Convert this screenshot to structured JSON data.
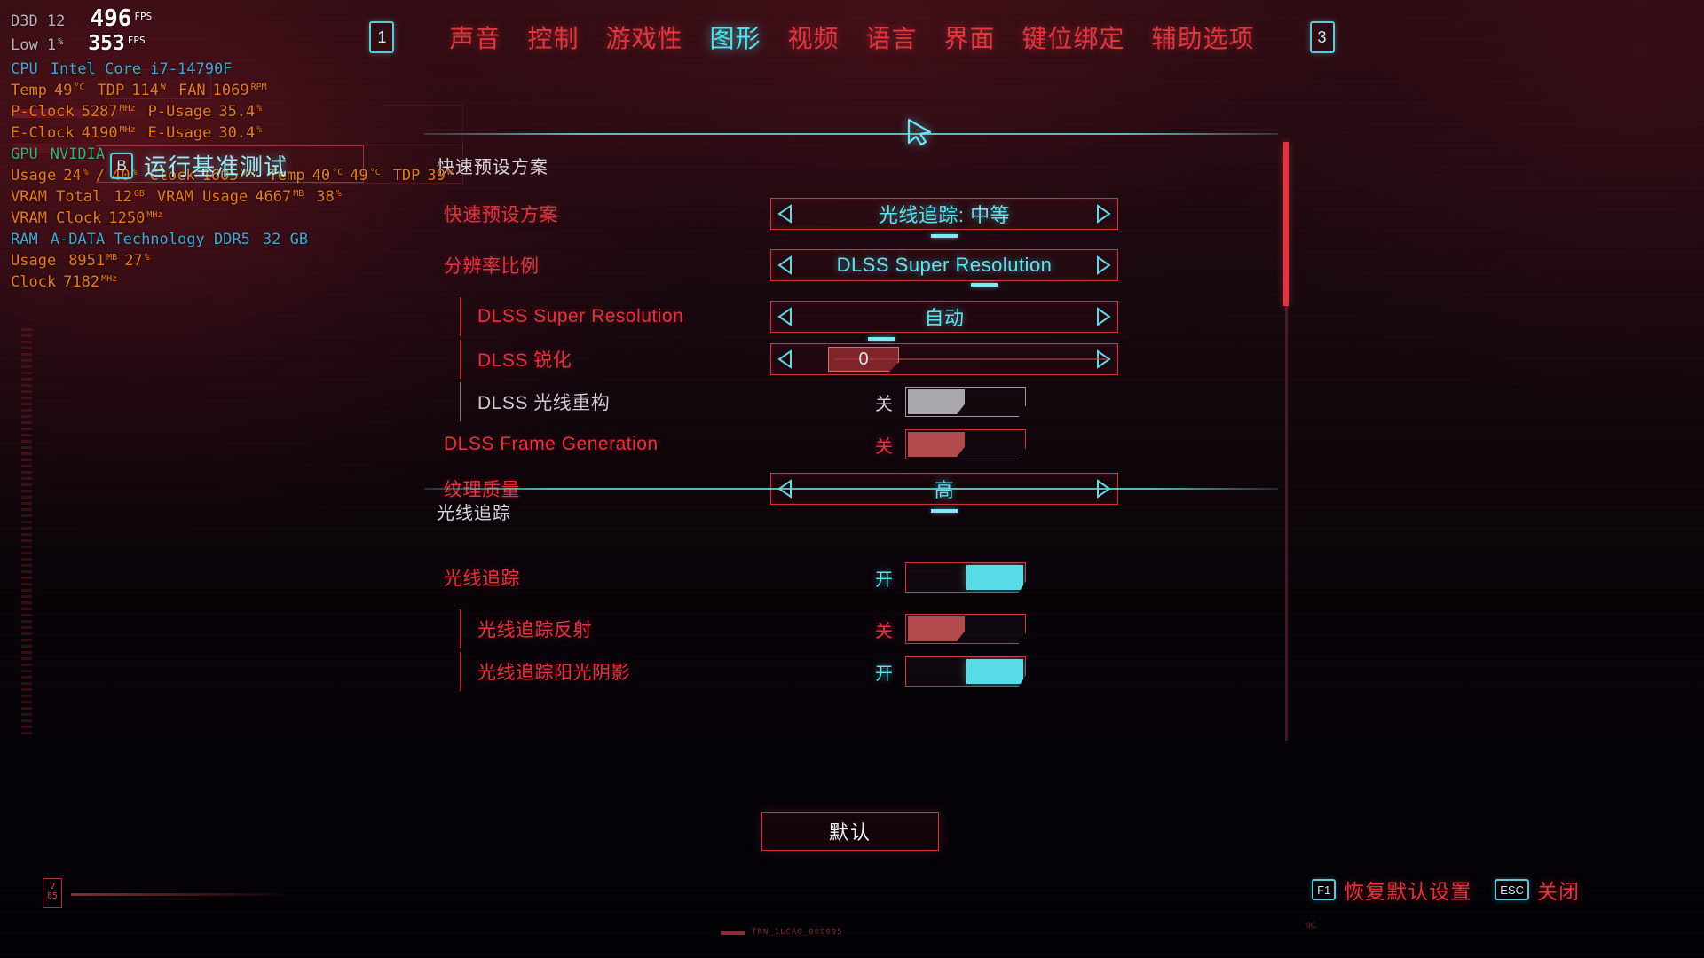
{
  "hud": {
    "api_label": "D3D 12",
    "fps_value": "496",
    "fps_unit": "FPS",
    "low_label": "Low 1",
    "low_pct": "%",
    "low_value": "353",
    "low_unit": "FPS",
    "cpu_label": "CPU",
    "cpu_name": "Intel Core i7-14790F",
    "cpu_temp_label": "Temp",
    "cpu_temp_value": "49",
    "cpu_temp_unit": "°C",
    "cpu_tdp_label": "TDP",
    "cpu_tdp_value": "114",
    "cpu_tdp_unit": "W",
    "cpu_fan_label": "FAN",
    "cpu_fan_value": "1069",
    "cpu_fan_unit": "RPM",
    "pclock_label": "P-Clock",
    "pclock_value": "5287",
    "pclock_unit": "MHz",
    "pusage_label": "P-Usage",
    "pusage_value": "35.4",
    "pusage_unit": "%",
    "eclock_label": "E-Clock",
    "eclock_value": "4190",
    "eclock_unit": "MHz",
    "eusage_label": "E-Usage",
    "eusage_value": "30.4",
    "eusage_unit": "%",
    "gpu_label": "GPU",
    "gpu_name": "NVIDIA",
    "gpu_usage_label": "Usage",
    "gpu_usage_value": "24",
    "gpu_usage_unit": "%",
    "gpu_usage_sep": "/",
    "gpu_usage_value2": "40",
    "gpu_usage_unit2": "%",
    "gpu_clock_label": "Clock",
    "gpu_clock_value": "1605",
    "gpu_clock_unit": "MHz",
    "gpu_temp_label": "Temp",
    "gpu_temp_value": "40",
    "gpu_temp_unit": "°C",
    "gpu_temp_value2": "49",
    "gpu_temp_unit2": "°C",
    "gpu_tdp_label": "TDP",
    "gpu_tdp_value": "39",
    "gpu_tdp_unit": "W",
    "vram_total_label": "VRAM Total",
    "vram_total_value": "12",
    "vram_total_unit": "GB",
    "vram_usage_label": "VRAM Usage",
    "vram_usage_value": "4667",
    "vram_usage_unit": "MB",
    "vram_usage_pct": "38",
    "vram_usage_pct_unit": "%",
    "vram_clock_label": "VRAM Clock",
    "vram_clock_value": "1250",
    "vram_clock_unit": "MHz",
    "ram_label": "RAM",
    "ram_name": "A-DATA Technology DDR5",
    "ram_size": "32 GB",
    "ram_usage_label": "Usage",
    "ram_usage_value": "8951",
    "ram_usage_unit": "MB",
    "ram_usage_pct": "27",
    "ram_usage_pct_unit": "%",
    "ram_clock_label": "Clock",
    "ram_clock_value": "7182",
    "ram_clock_unit": "MHz"
  },
  "benchmark": {
    "key": "B",
    "label": "运行基准测试"
  },
  "topnav": {
    "left_badge": "1",
    "right_badge": "3",
    "tabs": [
      {
        "label": "声音",
        "active": false
      },
      {
        "label": "控制",
        "active": false
      },
      {
        "label": "游戏性",
        "active": false
      },
      {
        "label": "图形",
        "active": true
      },
      {
        "label": "视频",
        "active": false
      },
      {
        "label": "语言",
        "active": false
      },
      {
        "label": "界面",
        "active": false
      },
      {
        "label": "键位绑定",
        "active": false
      },
      {
        "label": "辅助选项",
        "active": false
      }
    ]
  },
  "panel": {
    "section1_title": "快速预设方案",
    "section2_title": "光线追踪",
    "rows": [
      {
        "label": "快速预设方案",
        "type": "spinner",
        "value": "光线追踪: 中等",
        "left_arrow": "◁",
        "right_arrow": "▷",
        "indent": 0,
        "disabled": false,
        "underline": "center"
      },
      {
        "label": "分辨率比例",
        "type": "spinner",
        "value": "DLSS Super Resolution",
        "left_arrow": "◁",
        "right_arrow": "▷",
        "indent": 0,
        "disabled": false,
        "underline": "right"
      },
      {
        "label": "DLSS Super Resolution",
        "type": "spinner",
        "value": "自动",
        "left_arrow": "◁",
        "right_arrow": "▷",
        "indent": 1,
        "disabled": false,
        "underline": "left"
      },
      {
        "label": "DLSS 锐化",
        "type": "slider",
        "value": "0",
        "left_arrow": "◁",
        "right_arrow": "▷",
        "indent": 1,
        "disabled": false
      },
      {
        "label": "DLSS 光线重构",
        "type": "toggle",
        "state_label": "关",
        "state": "off",
        "indent": 1,
        "disabled": true
      },
      {
        "label": "DLSS Frame Generation",
        "type": "toggle",
        "state_label": "关",
        "state": "off",
        "indent": 0,
        "disabled": false
      },
      {
        "label": "纹理质量",
        "type": "spinner",
        "value": "高",
        "left_arrow": "◁",
        "right_arrow": "▷",
        "indent": 0,
        "disabled": false,
        "underline": "center"
      }
    ],
    "rt_rows": [
      {
        "label": "光线追踪",
        "type": "toggle",
        "state_label": "开",
        "state": "on",
        "indent": 0,
        "disabled": false
      },
      {
        "label": "光线追踪反射",
        "type": "toggle",
        "state_label": "关",
        "state": "off",
        "indent": 1,
        "disabled": false
      },
      {
        "label": "光线追踪阳光阴影",
        "type": "toggle",
        "state_label": "开",
        "state": "on",
        "indent": 1,
        "disabled": false
      }
    ]
  },
  "default_button": "默认",
  "footer": {
    "hints": [
      {
        "key": "F1",
        "label": "恢复默认设置"
      },
      {
        "key": "ESC",
        "label": "关闭"
      }
    ]
  },
  "watermark": {
    "text": "TRN_1LCA8_000095",
    "corner": "'9C"
  },
  "left_artifacts": {
    "vbox_top": "V",
    "vbox_bottom": "85",
    "numbers": ""
  },
  "colors": {
    "accent_red": "#e0343e",
    "accent_cyan": "#5fe3ef",
    "hud_orange": "#e8791f",
    "hud_cyan": "#3fa9d6",
    "hud_green": "#35b07a"
  }
}
